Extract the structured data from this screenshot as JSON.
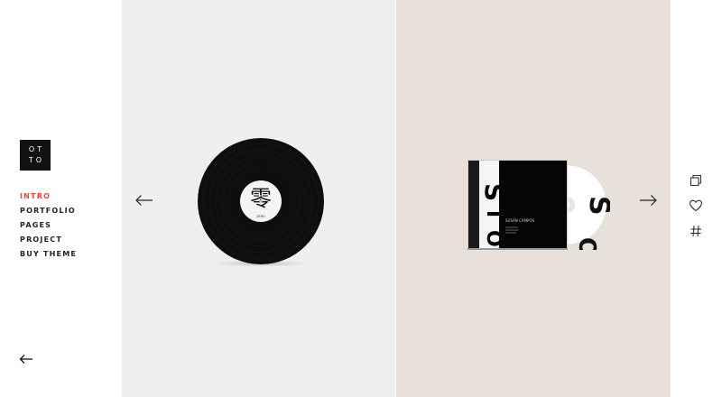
{
  "brand": {
    "line1": "OT",
    "line2": "TO"
  },
  "nav": {
    "items": [
      {
        "label": "INTRO",
        "active": true
      },
      {
        "label": "PORTFOLIO",
        "active": false
      },
      {
        "label": "PAGES",
        "active": false
      },
      {
        "label": "PROJECT",
        "active": false
      },
      {
        "label": "BUY THEME",
        "active": false
      }
    ]
  },
  "slides": {
    "left": {
      "kind": "vinyl-record",
      "label_glyph": "零",
      "label_sub": "ZERO"
    },
    "right": {
      "kind": "cd-case",
      "cover_title": "SUSAN CAMPOS",
      "disc_letters": "OIS"
    }
  },
  "icons": {
    "back": "arrow-left-icon",
    "prev": "arrow-left-icon",
    "next": "arrow-right-icon",
    "side": [
      "copy-icon",
      "heart-icon",
      "hash-icon"
    ]
  },
  "colors": {
    "accent": "#e8453c",
    "left_panel": "#efefef",
    "right_panel": "#e8e1da",
    "logo_bg": "#111111"
  }
}
